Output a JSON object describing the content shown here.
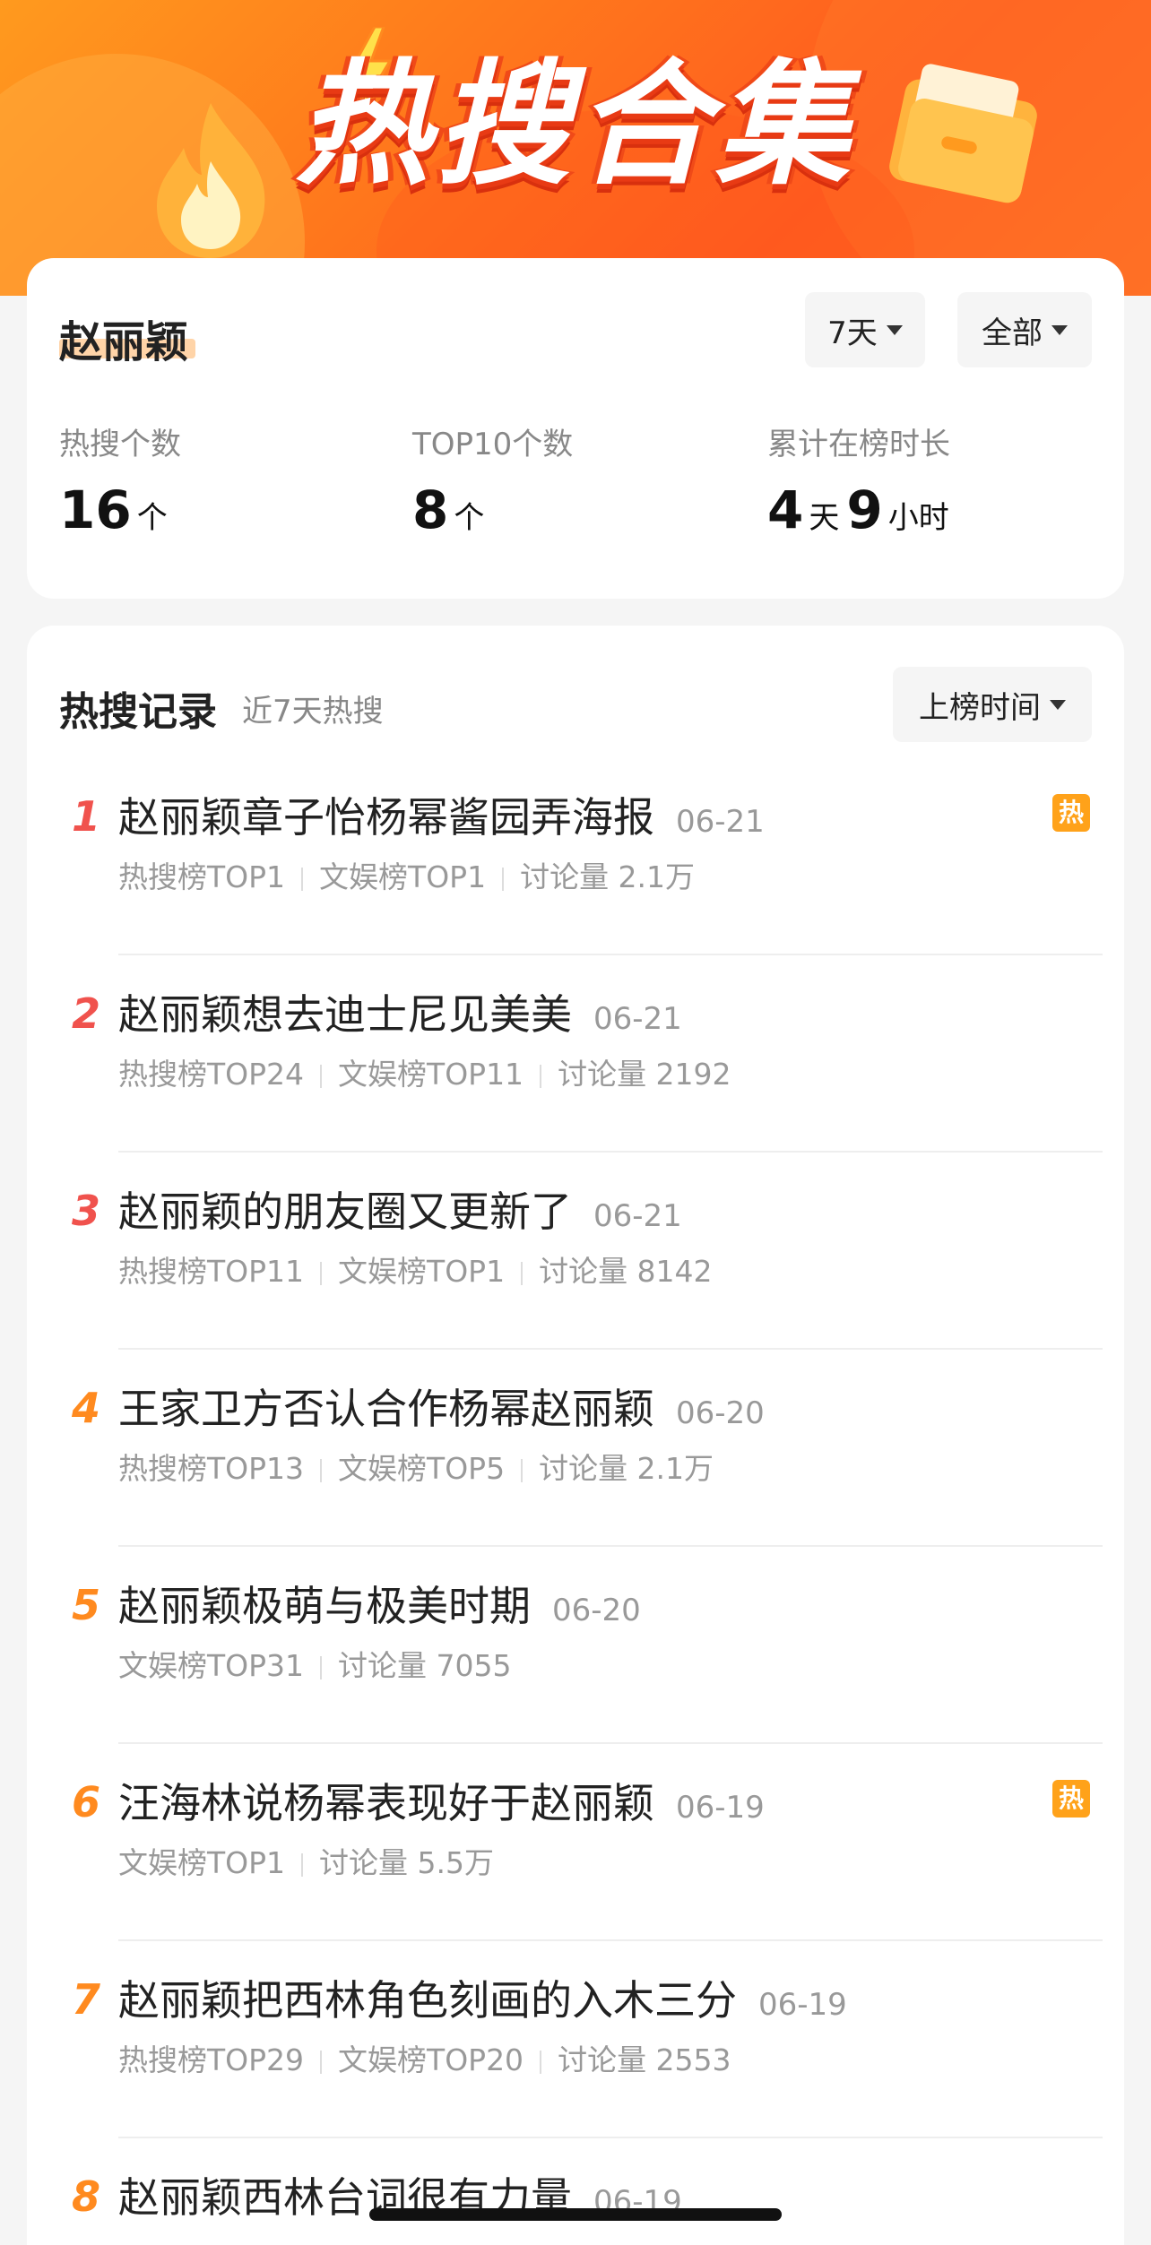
{
  "banner": {
    "title": "热搜合集"
  },
  "summary": {
    "name": "赵丽颖",
    "filters": {
      "range": "7天",
      "category": "全部"
    },
    "stats": [
      {
        "label": "热搜个数",
        "value": "16",
        "unit": "个"
      },
      {
        "label": "TOP10个数",
        "value": "8",
        "unit": "个"
      },
      {
        "label": "累计在榜时长",
        "days": "4",
        "days_unit": "天",
        "hours": "9",
        "hours_unit": "小时"
      }
    ]
  },
  "records": {
    "title": "热搜记录",
    "subtitle": "近7天热搜",
    "sort_label": "上榜时间",
    "hot_badge": "热",
    "colors": {
      "top3": "#f0524d",
      "rest": "#ff8a1f",
      "badge": "#ffa21a"
    },
    "items": [
      {
        "rank": "1",
        "title": "赵丽颖章子怡杨幂酱园弄海报",
        "date": "06-21",
        "meta": [
          "热搜榜TOP1",
          "文娱榜TOP1",
          "讨论量 2.1万"
        ],
        "hot": true
      },
      {
        "rank": "2",
        "title": "赵丽颖想去迪士尼见美美",
        "date": "06-21",
        "meta": [
          "热搜榜TOP24",
          "文娱榜TOP11",
          "讨论量 2192"
        ],
        "hot": false
      },
      {
        "rank": "3",
        "title": "赵丽颖的朋友圈又更新了",
        "date": "06-21",
        "meta": [
          "热搜榜TOP11",
          "文娱榜TOP1",
          "讨论量 8142"
        ],
        "hot": false
      },
      {
        "rank": "4",
        "title": "王家卫方否认合作杨幂赵丽颖",
        "date": "06-20",
        "meta": [
          "热搜榜TOP13",
          "文娱榜TOP5",
          "讨论量 2.1万"
        ],
        "hot": false
      },
      {
        "rank": "5",
        "title": "赵丽颖极萌与极美时期",
        "date": "06-20",
        "meta": [
          "文娱榜TOP31",
          "讨论量 7055"
        ],
        "hot": false
      },
      {
        "rank": "6",
        "title": "汪海林说杨幂表现好于赵丽颖",
        "date": "06-19",
        "meta": [
          "文娱榜TOP1",
          "讨论量 5.5万"
        ],
        "hot": true
      },
      {
        "rank": "7",
        "title": "赵丽颖把西林角色刻画的入木三分",
        "date": "06-19",
        "meta": [
          "热搜榜TOP29",
          "文娱榜TOP20",
          "讨论量 2553"
        ],
        "hot": false
      },
      {
        "rank": "8",
        "title": "赵丽颖西林台词很有力量",
        "date": "06-19",
        "meta": [],
        "hot": false
      }
    ]
  }
}
